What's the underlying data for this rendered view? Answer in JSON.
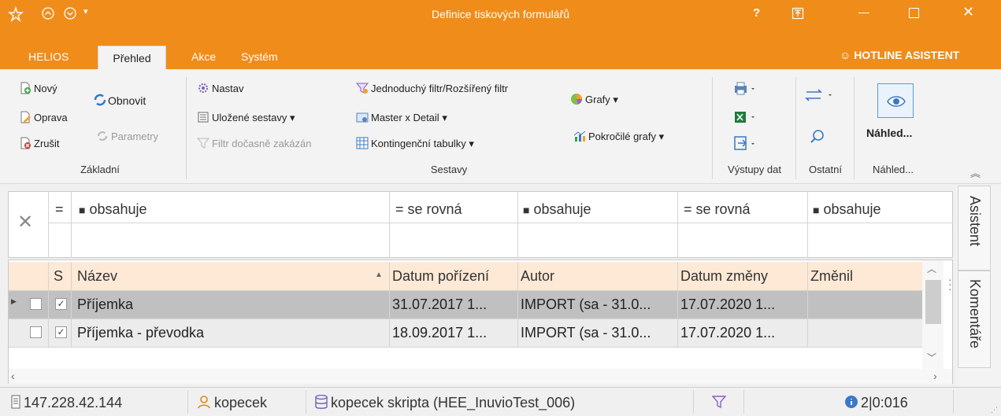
{
  "window": {
    "title": "Definice tiskových formulářů",
    "help": "?",
    "colors": {
      "accent": "#f08c1a",
      "selected_row": "#c0c0c0",
      "header_row": "#fde9d6"
    }
  },
  "menu_tabs": [
    "HELIOS",
    "Přehled",
    "Akce",
    "Systém"
  ],
  "hotline": "HOTLINE ASISTENT",
  "ribbon": {
    "zakladni": {
      "novy": "Nový",
      "oprava": "Oprava",
      "zrusit": "Zrušit",
      "obnovit": "Obnovit",
      "parametry": "Parametry",
      "group": "Základní"
    },
    "sestavy": {
      "nastav": "Nastav",
      "ulozene": "Uložené sestavy",
      "filtr_zakazan": "Filtr dočasně zakázán",
      "jednoduchy": "Jednoduchý filtr/Rozšířený filtr",
      "master": "Master x Detail",
      "kontingencni": "Kontingenční tabulky",
      "grafy": "Grafy",
      "pokrocile": "Pokročilé grafy",
      "group": "Sestavy"
    },
    "vystupy": {
      "group": "Výstupy dat"
    },
    "ostatni": {
      "group": "Ostatní"
    },
    "nahled": {
      "button": "Náhled...",
      "group": "Náhled..."
    }
  },
  "filter_row": {
    "ops": [
      "=",
      "obsahuje",
      "= se rovná",
      "obsahuje",
      "= se rovná",
      "obsahuje"
    ]
  },
  "table": {
    "headers": [
      "S",
      "Název",
      "Datum pořízení",
      "Autor",
      "Datum změny",
      "Změnil"
    ],
    "rows": [
      {
        "nazev": "Příjemka",
        "datum": "31.07.2017 1...",
        "autor": "IMPORT (sa - 31.0...",
        "zmena": "17.07.2020 1...",
        "zmenil": ""
      },
      {
        "nazev": "Příjemka - převodka",
        "datum": "18.09.2017 1...",
        "autor": "IMPORT (sa - 31.0...",
        "zmena": "17.07.2020 1...",
        "zmenil": ""
      }
    ]
  },
  "side_tabs": [
    "Asistent",
    "Komentáře"
  ],
  "status": {
    "ip": "147.228.42.144",
    "user": "kopecek",
    "db": "kopecek skripta (HEE_InuvioTest_006)",
    "counter": "2|0:016"
  }
}
